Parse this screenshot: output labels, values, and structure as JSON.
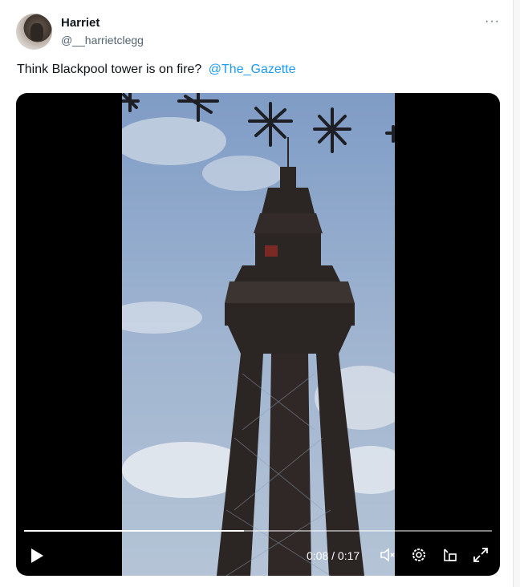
{
  "tweet": {
    "author_name": "Harriet",
    "author_handle": "@__harrietclegg",
    "more_label": "···",
    "text": "Think Blackpool tower is on fire?",
    "mention": "@The_Gazette"
  },
  "video": {
    "current_time": "0:08",
    "separator": " / ",
    "duration": "0:17",
    "progress_fraction": 0.47,
    "controls": [
      "play-icon",
      "mute-icon",
      "settings-icon",
      "picture-in-picture-icon",
      "fullscreen-icon"
    ]
  },
  "colors": {
    "mention": "#1d9bf0",
    "sky": "#8fa8c8",
    "tower": "#2b2523"
  }
}
